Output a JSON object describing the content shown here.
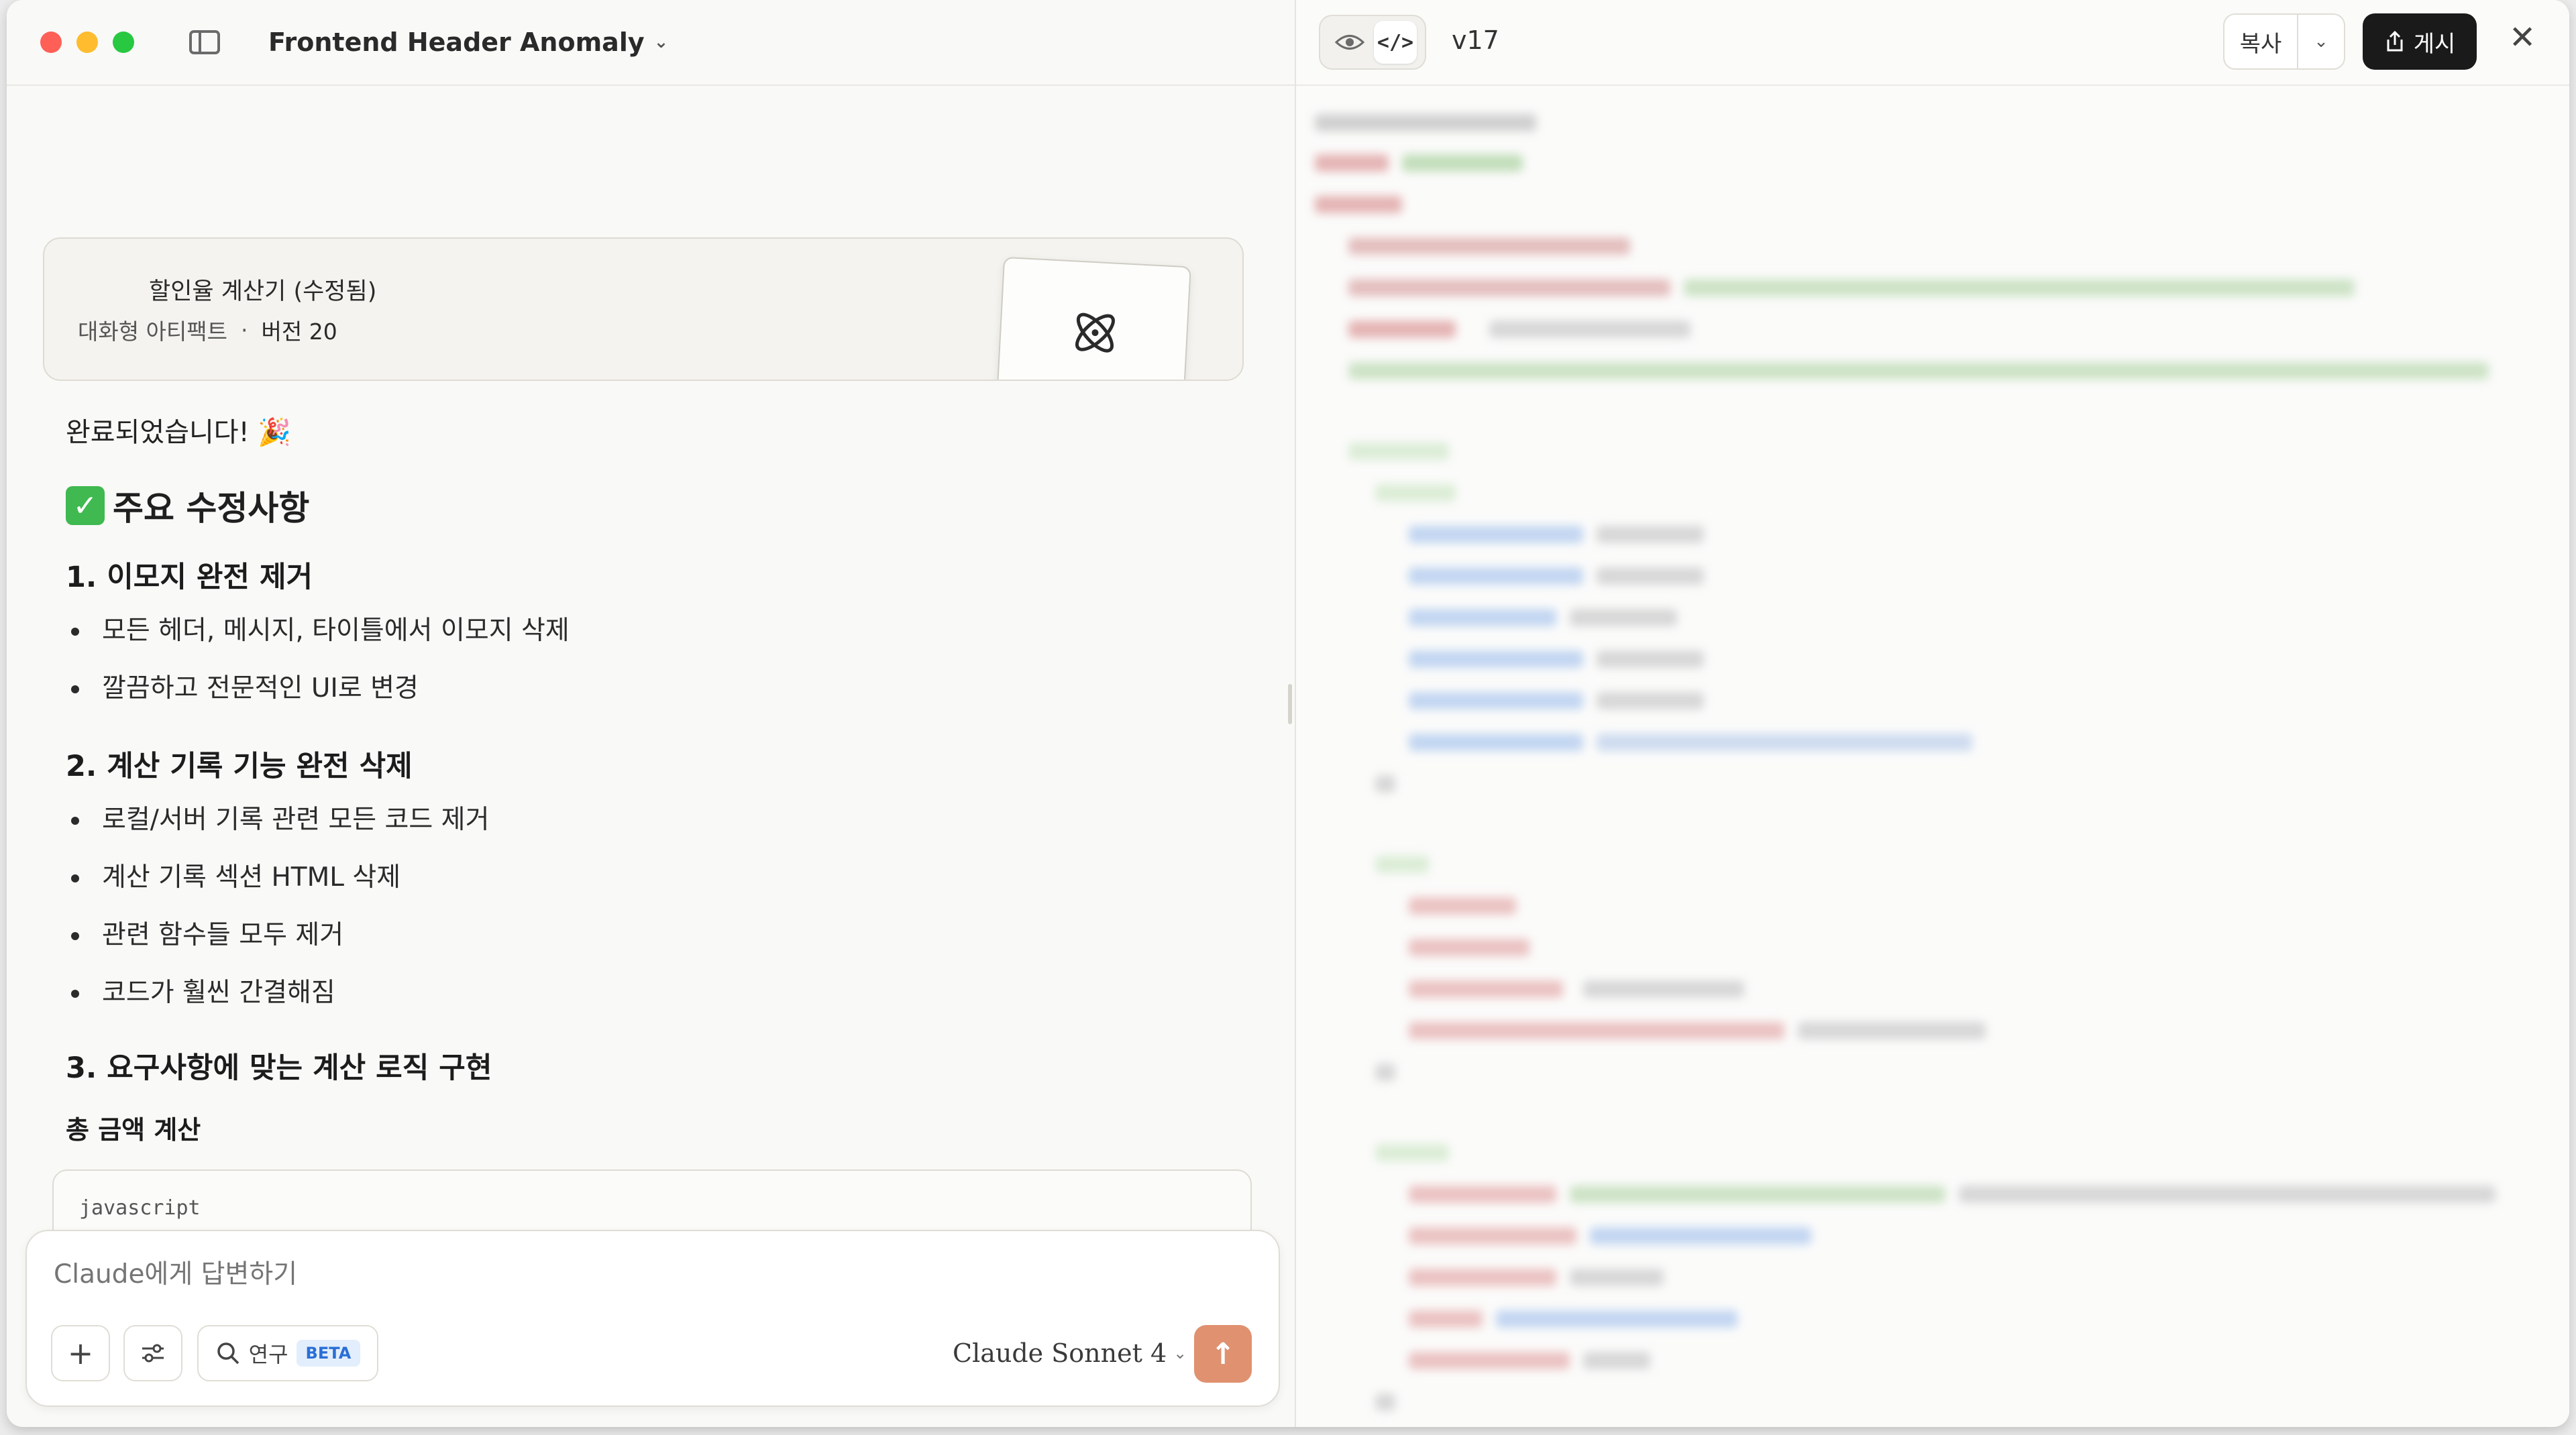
{
  "window": {
    "conversation_title": "Frontend Header Anomaly"
  },
  "artifact": {
    "title": "할인율 계산기 (수정됨)",
    "type_label": "대화형 아티팩트",
    "separator": "·",
    "version_label": "버전 20"
  },
  "message": {
    "done_text": "완료되었습니다! 🎉",
    "main_heading": "주요 수정사항",
    "sections": [
      {
        "heading": "1. 이모지 완전 제거",
        "bullets": [
          "모든 헤더, 메시지, 타이틀에서 이모지 삭제",
          "깔끔하고 전문적인 UI로 변경"
        ]
      },
      {
        "heading": "2. 계산 기록 기능 완전 삭제",
        "bullets": [
          "로컬/서버 기록 관련 모든 코드 제거",
          "계산 기록 섹션 HTML 삭제",
          "관련 함수들 모두 제거",
          "코드가 훨씬 간결해짐"
        ]
      },
      {
        "heading": "3. 요구사항에 맞는 계산 로직 구현",
        "bullets": []
      }
    ],
    "subheading": "총 금액 계산",
    "code_language": "javascript"
  },
  "composer": {
    "placeholder": "Claude에게 답변하기",
    "research_label": "연구",
    "beta_label": "BETA",
    "model_label": "Claude Sonnet 4"
  },
  "artifact_panel": {
    "version": "v17",
    "copy_label": "복사",
    "publish_label": "게시"
  },
  "colors": {
    "send_button": "#e0916f",
    "publish_button": "#1a1a1a",
    "beta_badge_text": "#2a6fd6"
  }
}
